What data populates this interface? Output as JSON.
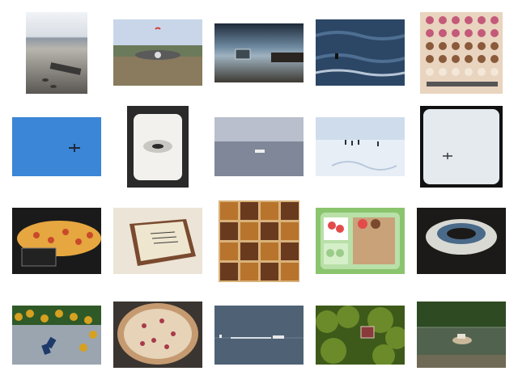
{
  "grid": {
    "rows": 4,
    "columns": 5,
    "thumbnails": [
      {
        "subject": "beach-footprints",
        "colors": [
          "#d8dde4",
          "#8c8a86",
          "#5a5652"
        ]
      },
      {
        "subject": "kite-over-field",
        "colors": [
          "#c9d6ea",
          "#6b7a5a",
          "#8a7a5e"
        ]
      },
      {
        "subject": "sea-storm-wreck",
        "colors": [
          "#1e2a3a",
          "#6f8aa0",
          "#3d3a33"
        ]
      },
      {
        "subject": "surfer-waves",
        "colors": [
          "#2c4666",
          "#4e6f92",
          "#b7c6d6"
        ]
      },
      {
        "subject": "donut-tray",
        "colors": [
          "#c45a7a",
          "#8a5a3a",
          "#e9d4bf"
        ]
      },
      {
        "subject": "airplane-blue-sky",
        "colors": [
          "#3b86d6",
          "#2d6fbf",
          "#1e2a38"
        ]
      },
      {
        "subject": "white-plate-close-up",
        "colors": [
          "#f2f1ee",
          "#c8c7c2",
          "#2a2a2a"
        ]
      },
      {
        "subject": "boat-gray-sea",
        "colors": [
          "#b9bfcc",
          "#7f8798",
          "#eeeeee"
        ]
      },
      {
        "subject": "snow-field-figures",
        "colors": [
          "#cfdceb",
          "#e7eef6",
          "#2a2f3a"
        ]
      },
      {
        "subject": "plane-white-sky",
        "colors": [
          "#e5eaef",
          "#111111",
          "#3a3a3a"
        ]
      },
      {
        "subject": "pizza-display",
        "colors": [
          "#c94a2a",
          "#e6a640",
          "#1a1a1a"
        ]
      },
      {
        "subject": "cake-slice",
        "colors": [
          "#ece4d6",
          "#7a4a2f",
          "#3a3a3a"
        ]
      },
      {
        "subject": "food-collage",
        "colors": [
          "#b8742d",
          "#d9b27a",
          "#6a3a1f"
        ]
      },
      {
        "subject": "lunchbox",
        "colors": [
          "#8ac56e",
          "#c9a27a",
          "#e34b4b"
        ]
      },
      {
        "subject": "frisbee",
        "colors": [
          "#1b1a18",
          "#d9d9d4",
          "#4a6a8a"
        ]
      },
      {
        "subject": "yellow-flowers-phone",
        "colors": [
          "#d6a020",
          "#2f5a28",
          "#9aa5b0"
        ]
      },
      {
        "subject": "pizza-whole",
        "colors": [
          "#3a3530",
          "#c59a70",
          "#a83a4a"
        ]
      },
      {
        "subject": "lake-boat",
        "colors": [
          "#4f6275",
          "#2f3d4d",
          "#e8e8e8"
        ]
      },
      {
        "subject": "green-trees-sign",
        "colors": [
          "#6b8a2a",
          "#3e5a1a",
          "#8a3a3a"
        ]
      },
      {
        "subject": "lake-forest-boat",
        "colors": [
          "#2e4a23",
          "#51624e",
          "#c9b89a"
        ]
      }
    ]
  }
}
